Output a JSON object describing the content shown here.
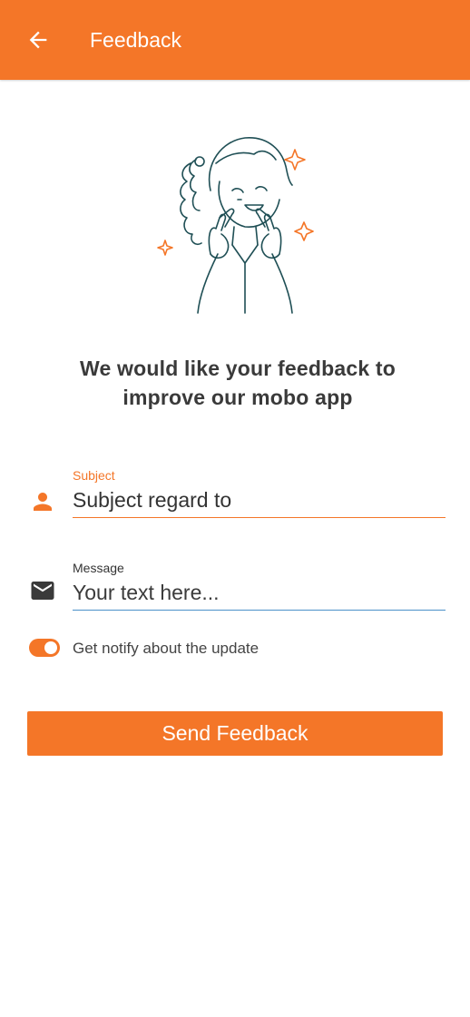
{
  "header": {
    "title": "Feedback",
    "back_icon": "arrow-left-icon"
  },
  "illustration": {
    "icon": "girl-peace-sign-illustration"
  },
  "headline": {
    "line1": "We would like your feedback to",
    "line2": "improve our mobo app"
  },
  "form": {
    "subject": {
      "label": "Subject",
      "value": "Subject regard to",
      "icon": "person-icon"
    },
    "message": {
      "label": "Message",
      "placeholder": "Your text here...",
      "icon": "mail-icon"
    },
    "notify": {
      "label": "Get notify about the update",
      "enabled": true
    }
  },
  "actions": {
    "send_label": "Send Feedback"
  },
  "colors": {
    "accent": "#f47628",
    "message_underline": "#4a90c8",
    "text": "#3a3a3a"
  }
}
